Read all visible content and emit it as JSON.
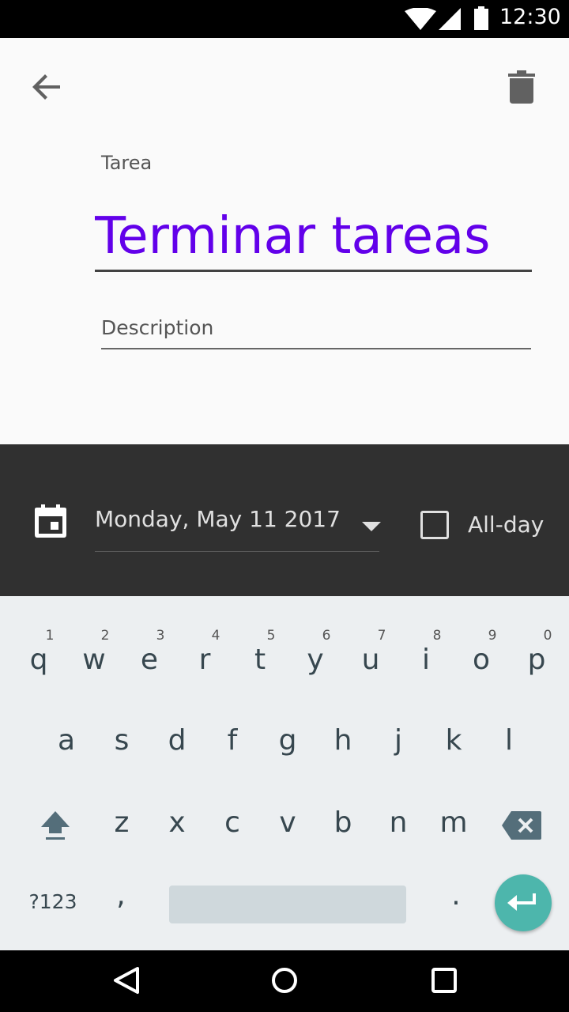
{
  "status_bar": {
    "time": "12:30"
  },
  "form": {
    "title_label": "Tarea",
    "title_value": "Terminar tareas",
    "description_placeholder": "Description",
    "description_value": ""
  },
  "schedule": {
    "date": "Monday, May 11 2017",
    "allday_label": "All-day",
    "allday_checked": false
  },
  "keyboard": {
    "row1": [
      {
        "ch": "q",
        "hint": "1"
      },
      {
        "ch": "w",
        "hint": "2"
      },
      {
        "ch": "e",
        "hint": "3"
      },
      {
        "ch": "r",
        "hint": "4"
      },
      {
        "ch": "t",
        "hint": "5"
      },
      {
        "ch": "y",
        "hint": "6"
      },
      {
        "ch": "u",
        "hint": "7"
      },
      {
        "ch": "i",
        "hint": "8"
      },
      {
        "ch": "o",
        "hint": "9"
      },
      {
        "ch": "p",
        "hint": "0"
      }
    ],
    "row2": [
      "a",
      "s",
      "d",
      "f",
      "g",
      "h",
      "j",
      "k",
      "l"
    ],
    "row3": [
      "z",
      "x",
      "c",
      "v",
      "b",
      "n",
      "m"
    ],
    "symbols_label": "?123",
    "comma": ",",
    "period": "."
  },
  "colors": {
    "accent": "#6200ea",
    "dark_panel": "#303030",
    "enter_key": "#4db6ac"
  },
  "icons": {
    "back": "arrow-back-icon",
    "delete": "trash-icon",
    "calendar": "calendar-icon",
    "dropdown": "dropdown-arrow-icon",
    "shift": "shift-icon",
    "backspace": "backspace-icon",
    "enter": "enter-icon"
  }
}
